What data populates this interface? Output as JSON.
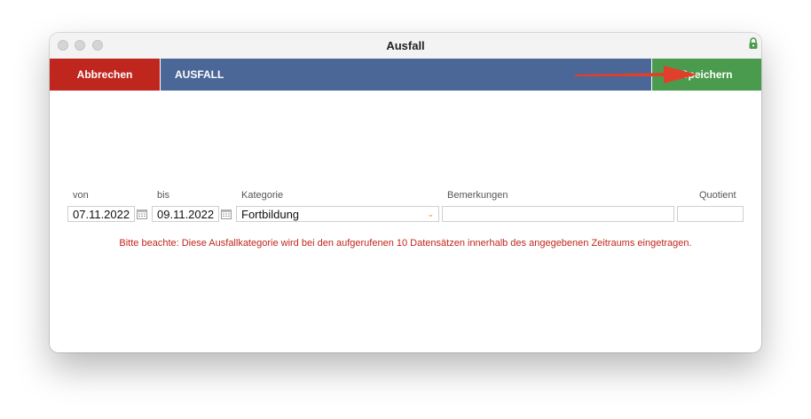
{
  "window": {
    "title": "Ausfall"
  },
  "toolbar": {
    "cancel_label": "Abbrechen",
    "section_title": "AUSFALL",
    "save_label": "Speichern"
  },
  "form": {
    "von": {
      "label": "von",
      "value": "07.11.2022"
    },
    "bis": {
      "label": "bis",
      "value": "09.11.2022"
    },
    "kategorie": {
      "label": "Kategorie",
      "value": "Fortbildung"
    },
    "bemerkungen": {
      "label": "Bemerkungen",
      "value": ""
    },
    "quotient": {
      "label": "Quotient",
      "value": ""
    }
  },
  "note": "Bitte beachte: Diese Ausfallkategorie wird bei den aufgerufenen 10 Datensätzen innerhalb des angegebenen Zeitraums eingetragen.",
  "colors": {
    "cancel": "#bf261e",
    "header": "#4a6797",
    "save": "#4a9b4d",
    "arrow": "#e0402b",
    "note": "#c0261c"
  }
}
